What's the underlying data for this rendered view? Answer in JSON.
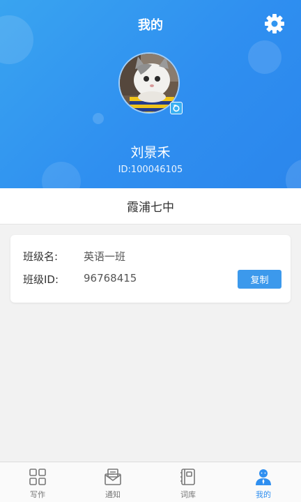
{
  "header": {
    "title": "我的",
    "settings_icon": "gear-icon",
    "user_name": "刘景禾",
    "user_id": "ID:100046105",
    "avatar": "user-avatar-cat",
    "avatar_badge_icon": "edit-badge-icon",
    "gradient": [
      "#39a4f0",
      "#2b86ec"
    ]
  },
  "school": {
    "name": "霞浦七中"
  },
  "class_card": {
    "name_label": "班级名:",
    "name_value": "英语一班",
    "id_label": "班级ID:",
    "id_value": "96768415",
    "copy_label": "复制"
  },
  "tabbar": {
    "items": [
      {
        "label": "写作",
        "icon": "grid-icon",
        "active": false
      },
      {
        "label": "通知",
        "icon": "mail-icon",
        "active": false
      },
      {
        "label": "词库",
        "icon": "notebook-icon",
        "active": false
      },
      {
        "label": "我的",
        "icon": "profile-icon",
        "active": true
      }
    ],
    "active_color": "#2f8ff0",
    "inactive_color": "#777777"
  }
}
